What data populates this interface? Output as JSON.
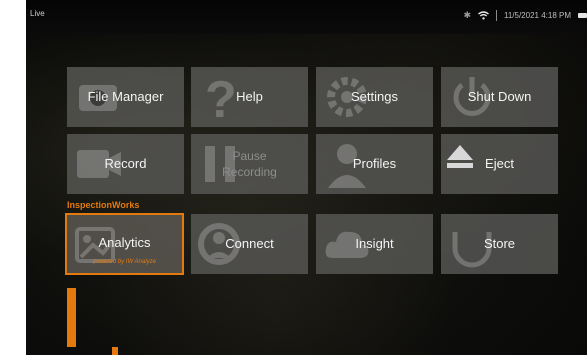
{
  "status": {
    "mode": "Live",
    "datetime": "11/5/2021 4:18 PM",
    "icons": [
      "bluetooth-icon",
      "wifi-icon",
      "battery-icon"
    ]
  },
  "menu": {
    "row1": [
      {
        "label": "File Manager",
        "icon": "camera-icon"
      },
      {
        "label": "Help",
        "icon": "question-icon"
      },
      {
        "label": "Settings",
        "icon": "gear-icon"
      },
      {
        "label": "Shut Down",
        "icon": "power-icon"
      }
    ],
    "row2": [
      {
        "label": "Record",
        "icon": "record-icon"
      },
      {
        "label": "Pause Recording",
        "icon": "pause-icon",
        "disabled": true
      },
      {
        "label": "Profiles",
        "icon": "person-icon"
      },
      {
        "label": "Eject",
        "icon": "eject-icon"
      }
    ],
    "section_label": "InspectionWorks",
    "row3": [
      {
        "label": "Analytics",
        "sub": "powered by IW Analyze",
        "icon": "analytics-icon",
        "selected": true
      },
      {
        "label": "Connect",
        "icon": "connect-icon"
      },
      {
        "label": "Insight",
        "icon": "cloud-icon"
      },
      {
        "label": "Store",
        "icon": "store-icon"
      }
    ]
  },
  "colors": {
    "accent": "#e37a10",
    "tile": "#585856",
    "status_bg": "#080808"
  }
}
